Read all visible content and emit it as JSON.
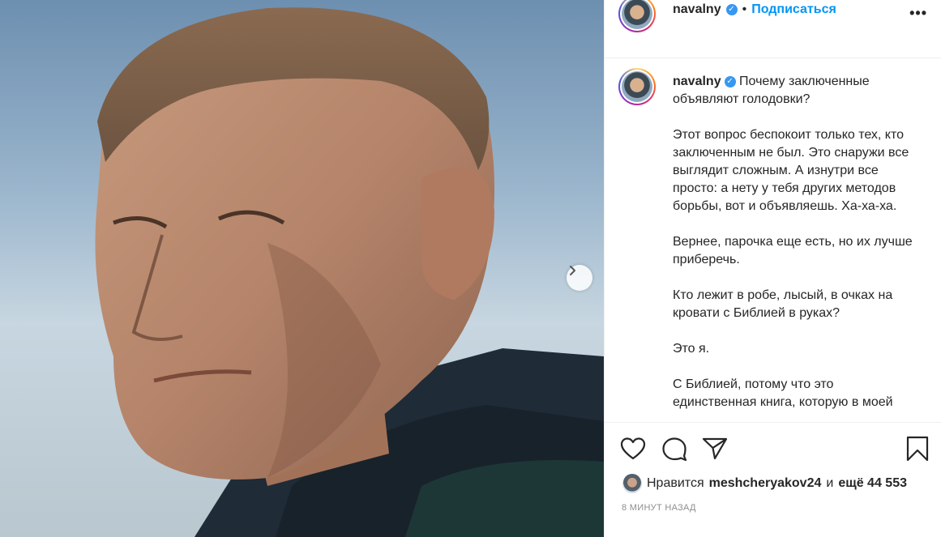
{
  "post_photo": {
    "description_icon": "portrait-photo",
    "next_button_icon": "chevron-right-icon"
  },
  "header": {
    "username": "navalny",
    "verified_icon": "verified-badge-icon",
    "separator": "•",
    "follow_label": "Подписаться",
    "more_icon": "•••"
  },
  "caption": {
    "username": "navalny",
    "paragraphs": [
      "Почему заключенные объявляют голодовки?",
      "Этот вопрос беспокоит только тех, кто заключенным не был. Это снаружи все выглядит сложным. А изнутри все просто: а нету у тебя других методов борьбы, вот и объявляешь. Ха-ха-ха.",
      "Вернее, парочка еще есть, но их лучше приберечь.",
      "Кто лежит в робе, лысый, в очках на кровати с Библией в руках?",
      "Это я.",
      "С Библией, потому что это единственная книга, которую в моей"
    ]
  },
  "actions": {
    "like_icon": "heart-icon",
    "comment_icon": "comment-icon",
    "share_icon": "send-icon",
    "save_icon": "bookmark-icon"
  },
  "likes": {
    "prefix": "Нравится",
    "user": "meshcheryakov24",
    "conjunction": "и",
    "rest": "ещё 44 553"
  },
  "timestamp": "8 МИНУТ НАЗАД",
  "colors": {
    "accent": "#0095f6",
    "verified": "#3897f0",
    "text": "#262626",
    "muted": "#8e8e8e"
  }
}
